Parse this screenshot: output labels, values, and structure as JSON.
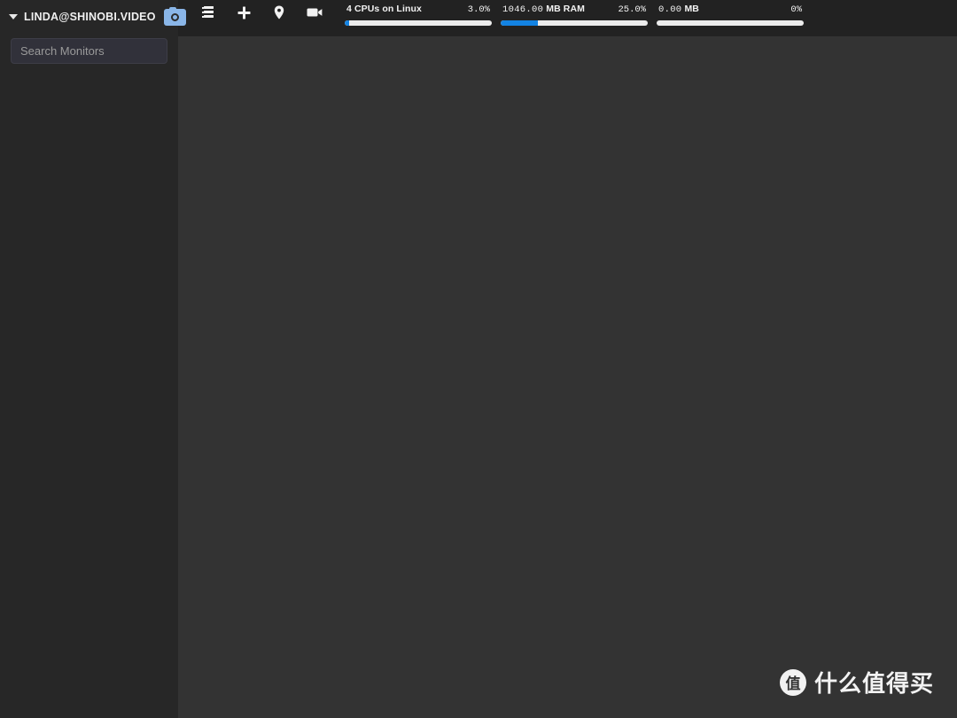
{
  "sidebar": {
    "account": {
      "caret_icon": "chevron-down-icon",
      "name": "LINDA@SHINOBI.VIDEO",
      "badge_icon": "camera-icon"
    },
    "search": {
      "value": "",
      "placeholder": "Search Monitors"
    },
    "monitors": []
  },
  "topbar": {
    "tools": [
      {
        "icon": "layers-list-icon",
        "label": "Monitor List"
      },
      {
        "icon": "plus-icon",
        "label": "Add Monitor"
      },
      {
        "icon": "map-pin-icon",
        "label": "Map"
      },
      {
        "icon": "video-camera-icon",
        "label": "Camera"
      }
    ],
    "stats": [
      {
        "name": "cpu",
        "label": "4 CPUs on Linux",
        "value": "",
        "unit": "4 CPUs on Linux",
        "percent_text": "3.0%",
        "percent": 3.0,
        "bold_all": true
      },
      {
        "name": "ram",
        "label": "1046.00 MB RAM",
        "value": "1046.00",
        "unit": "MB RAM",
        "percent_text": "25.0%",
        "percent": 25.0,
        "bold_all": false
      },
      {
        "name": "disk",
        "label": "0.00 MB",
        "value": "0.00",
        "unit": "MB",
        "percent_text": "0%",
        "percent": 0,
        "bold_all": false
      }
    ]
  },
  "stage": {
    "monitors": []
  },
  "watermark": {
    "logo_text": "值",
    "text": "什么值得买"
  },
  "colors": {
    "accent_blue": "#1383e3",
    "badge_blue": "#8ab6e8",
    "sidebar_bg": "#272727",
    "topbar_bg": "#222222",
    "stage_bg": "#333333",
    "track": "#ececec"
  }
}
